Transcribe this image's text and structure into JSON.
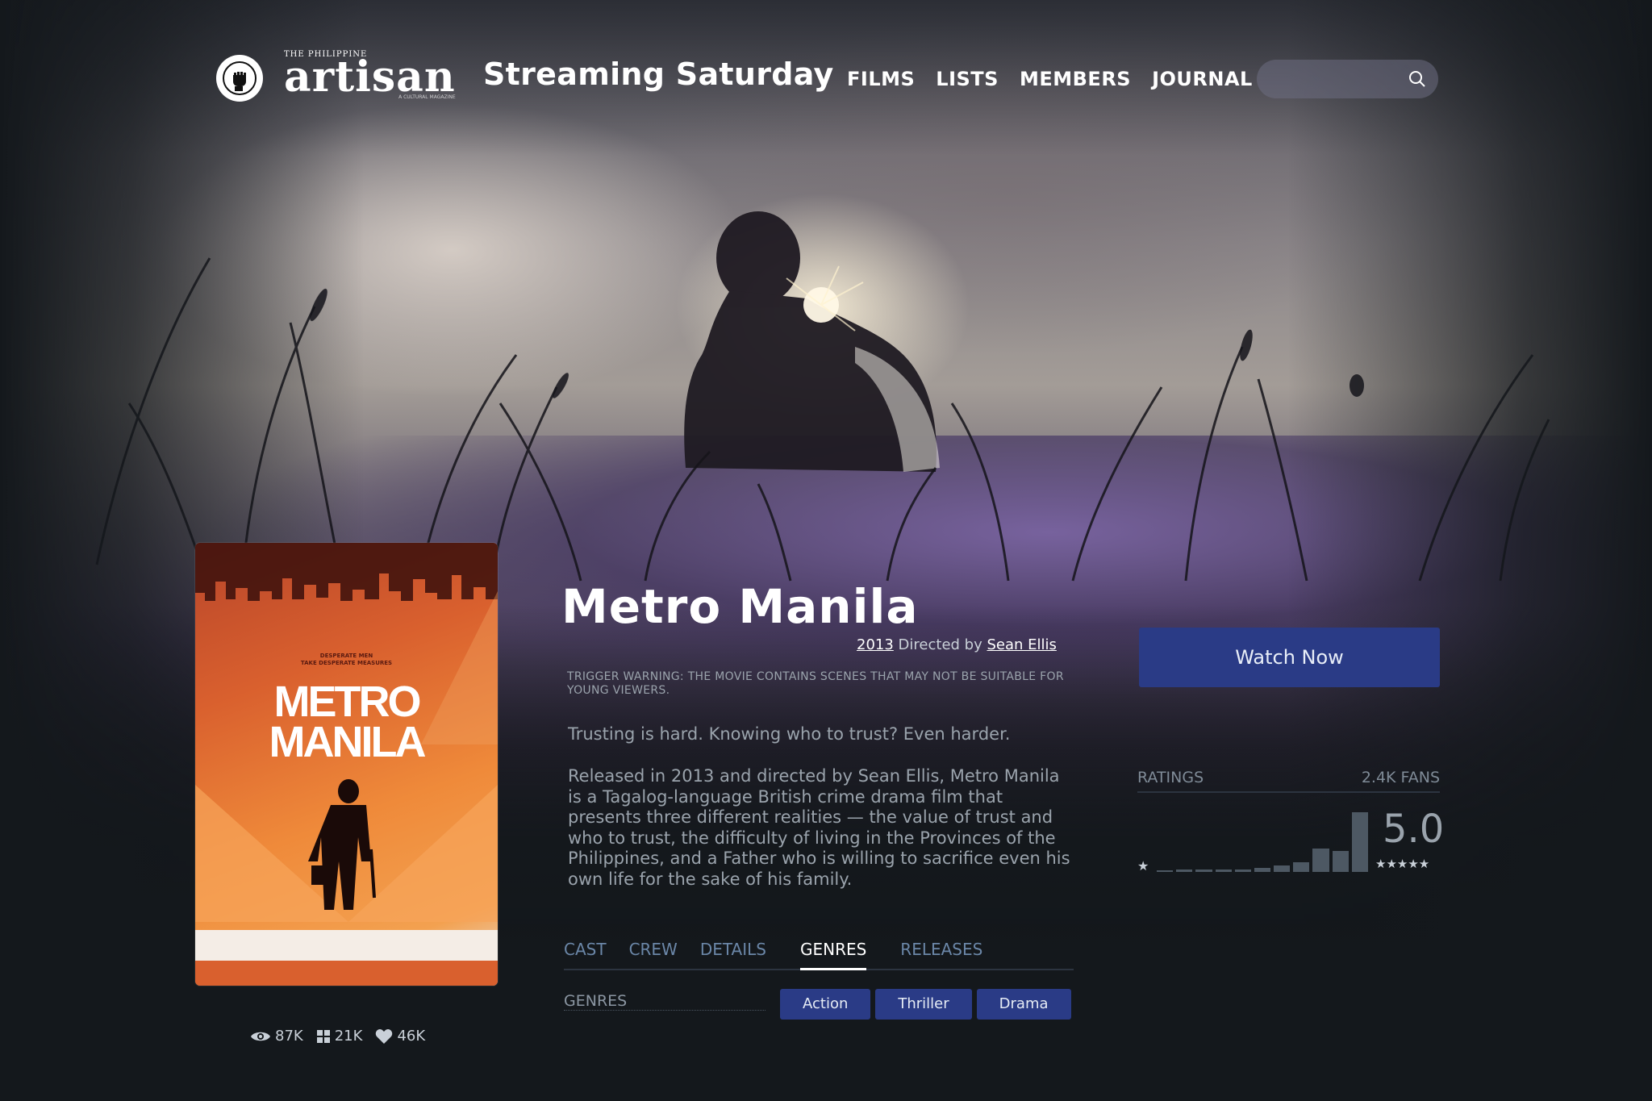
{
  "header": {
    "logo_top": "THE PHILIPPINE",
    "logo_word": "artisan",
    "logo_tag": "A CULTURAL MAGAZINE",
    "site_name": "Streaming Saturday",
    "nav": [
      "FILMS",
      "LISTS",
      "MEMBERS",
      "JOURNAL"
    ],
    "search_value": ""
  },
  "poster": {
    "tagline": "DESPERATE MEN\nTAKE DESPERATE MEASURES",
    "title_line1": "METRO",
    "title_line2": "MANILA"
  },
  "stats": {
    "views": "87K",
    "lists": "21K",
    "likes": "46K"
  },
  "film": {
    "title": "Metro Manila",
    "year": "2013",
    "directed_by": "Directed by",
    "director": "Sean Ellis",
    "warning": "TRIGGER WARNING: THE MOVIE CONTAINS SCENES THAT MAY NOT BE SUITABLE FOR YOUNG VIEWERS.",
    "tagline": "Trusting is hard. Knowing who to trust? Even harder.",
    "synopsis": "Released in 2013 and directed by Sean Ellis, Metro Manila is a Tagalog-language British crime drama film that presents three different realities — the value of trust and who to trust, the difficulty of living in the Provinces of the Philippines, and a Father who is willing to sacrifice even his own life for the sake of his family."
  },
  "tabs": [
    "CAST",
    "CREW",
    "DETAILS",
    "GENRES",
    "RELEASES"
  ],
  "active_tab": "GENRES",
  "genres": {
    "label": "GENRES",
    "items": [
      "Action",
      "Thriller",
      "Drama"
    ]
  },
  "sidebar": {
    "watch_label": "Watch Now",
    "ratings_label": "RATINGS",
    "fans": "2.4K FANS",
    "average": "5.0",
    "histogram": [
      0.02,
      0.03,
      0.03,
      0.03,
      0.03,
      0.05,
      0.08,
      0.12,
      0.28,
      0.25,
      0.72
    ]
  },
  "colors": {
    "accent": "#2a3b86",
    "background": "#14181c"
  }
}
